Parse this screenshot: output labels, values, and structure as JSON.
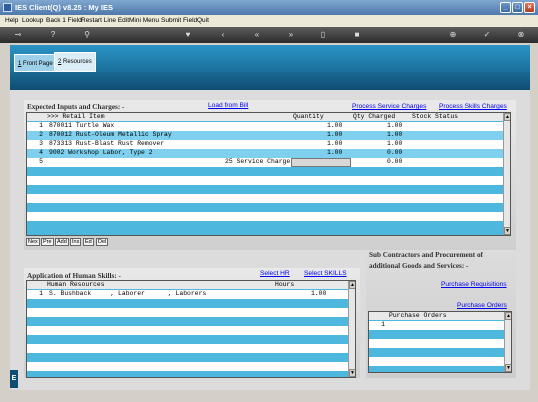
{
  "window": {
    "title": "IES Client(Q) v8.25 : My IES"
  },
  "menu": [
    "Help",
    "Lookup",
    "Back 1 Field",
    "Restart Line Edit",
    "Mini Menu",
    "Submit Field",
    "Quit"
  ],
  "toolbar": {
    "help_glyph": "?"
  },
  "tabs": [
    {
      "num": "1",
      "label": " Front Page"
    },
    {
      "num": "2",
      "label": " Resources"
    }
  ],
  "expected": {
    "title": "Expected Inputs and Charges: -",
    "load_link": "Load from Bill",
    "service_link": "Process Service Charges",
    "skills_link": "Process Skills Charges",
    "headers": {
      "item": ">>> Retail Item",
      "qty": "Quantity",
      "charged": "Qty Charged",
      "status": "Stock Status"
    },
    "rows": [
      {
        "n": "1",
        "item": "870011 Turtle Wax",
        "qty": "1.00",
        "charged": "1.00"
      },
      {
        "n": "2",
        "item": "870012 Rust-Oleum Metallic Spray",
        "qty": "1.00",
        "charged": "1.00"
      },
      {
        "n": "3",
        "item": "873313 Rust-Blast Rust Remover",
        "qty": "1.00",
        "charged": "1.00"
      },
      {
        "n": "4",
        "item": "9002 Workshop Labor, Type 2",
        "qty": "1.00",
        "charged": "0.00"
      },
      {
        "n": "5",
        "item": "25 Service Charge",
        "qty": "",
        "charged": "0.00"
      }
    ],
    "nav": [
      "Nex",
      "Pre",
      "Add",
      "Ins",
      "Ed",
      "Del"
    ]
  },
  "subcontractors": {
    "title_line1": "Sub Contractors and Procurement of",
    "title_line2": "additional Goods and Services: -",
    "requisitions_link": "Purchase Requisitions",
    "orders_link": "Purchase Orders",
    "po_header": "Purchase Orders",
    "po_rows": [
      {
        "n": "1",
        "text": ""
      }
    ]
  },
  "skills": {
    "title": "Application of Human Skills: -",
    "select_hr": "Select HR",
    "select_skills": "Select SKILLS",
    "headers": {
      "resource": "Human Resources",
      "hours": "Hours"
    },
    "rows": [
      {
        "n": "1",
        "resource": "S. Bushback     , Laborer      , Laborers",
        "hours": "1.00"
      }
    ]
  },
  "sidebar_letter": "E"
}
